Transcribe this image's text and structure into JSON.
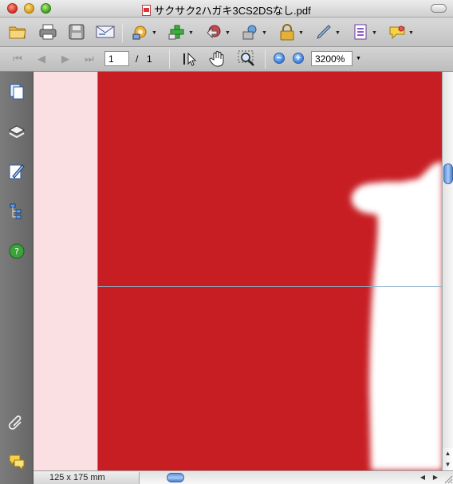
{
  "window": {
    "title": "サクサク2ハガキ3CS2DSなし.pdf"
  },
  "toolbar1": {
    "buttons": [
      {
        "name": "open-icon"
      },
      {
        "name": "print-icon"
      },
      {
        "name": "save-icon"
      },
      {
        "name": "email-icon"
      },
      {
        "name": "secure-icon"
      },
      {
        "name": "create-pdf-icon"
      },
      {
        "name": "export-icon"
      },
      {
        "name": "sign-icon"
      },
      {
        "name": "lock-icon"
      },
      {
        "name": "pen-icon"
      },
      {
        "name": "forms-icon"
      },
      {
        "name": "comment-icon"
      }
    ]
  },
  "toolbar2": {
    "page_number": "1",
    "page_separator": "/",
    "page_total": "1",
    "zoom": "3200%"
  },
  "navpane": {
    "icons": [
      "pages-icon",
      "layers-icon",
      "signatures-icon",
      "model-tree-icon",
      "help-icon",
      "attachments-icon",
      "comments-icon"
    ]
  },
  "status": {
    "page_size": "125 x 175 mm"
  },
  "colors": {
    "document_red": "#c71e24",
    "pink_margin": "#fbe0e3",
    "nav_gray": "#707070"
  }
}
